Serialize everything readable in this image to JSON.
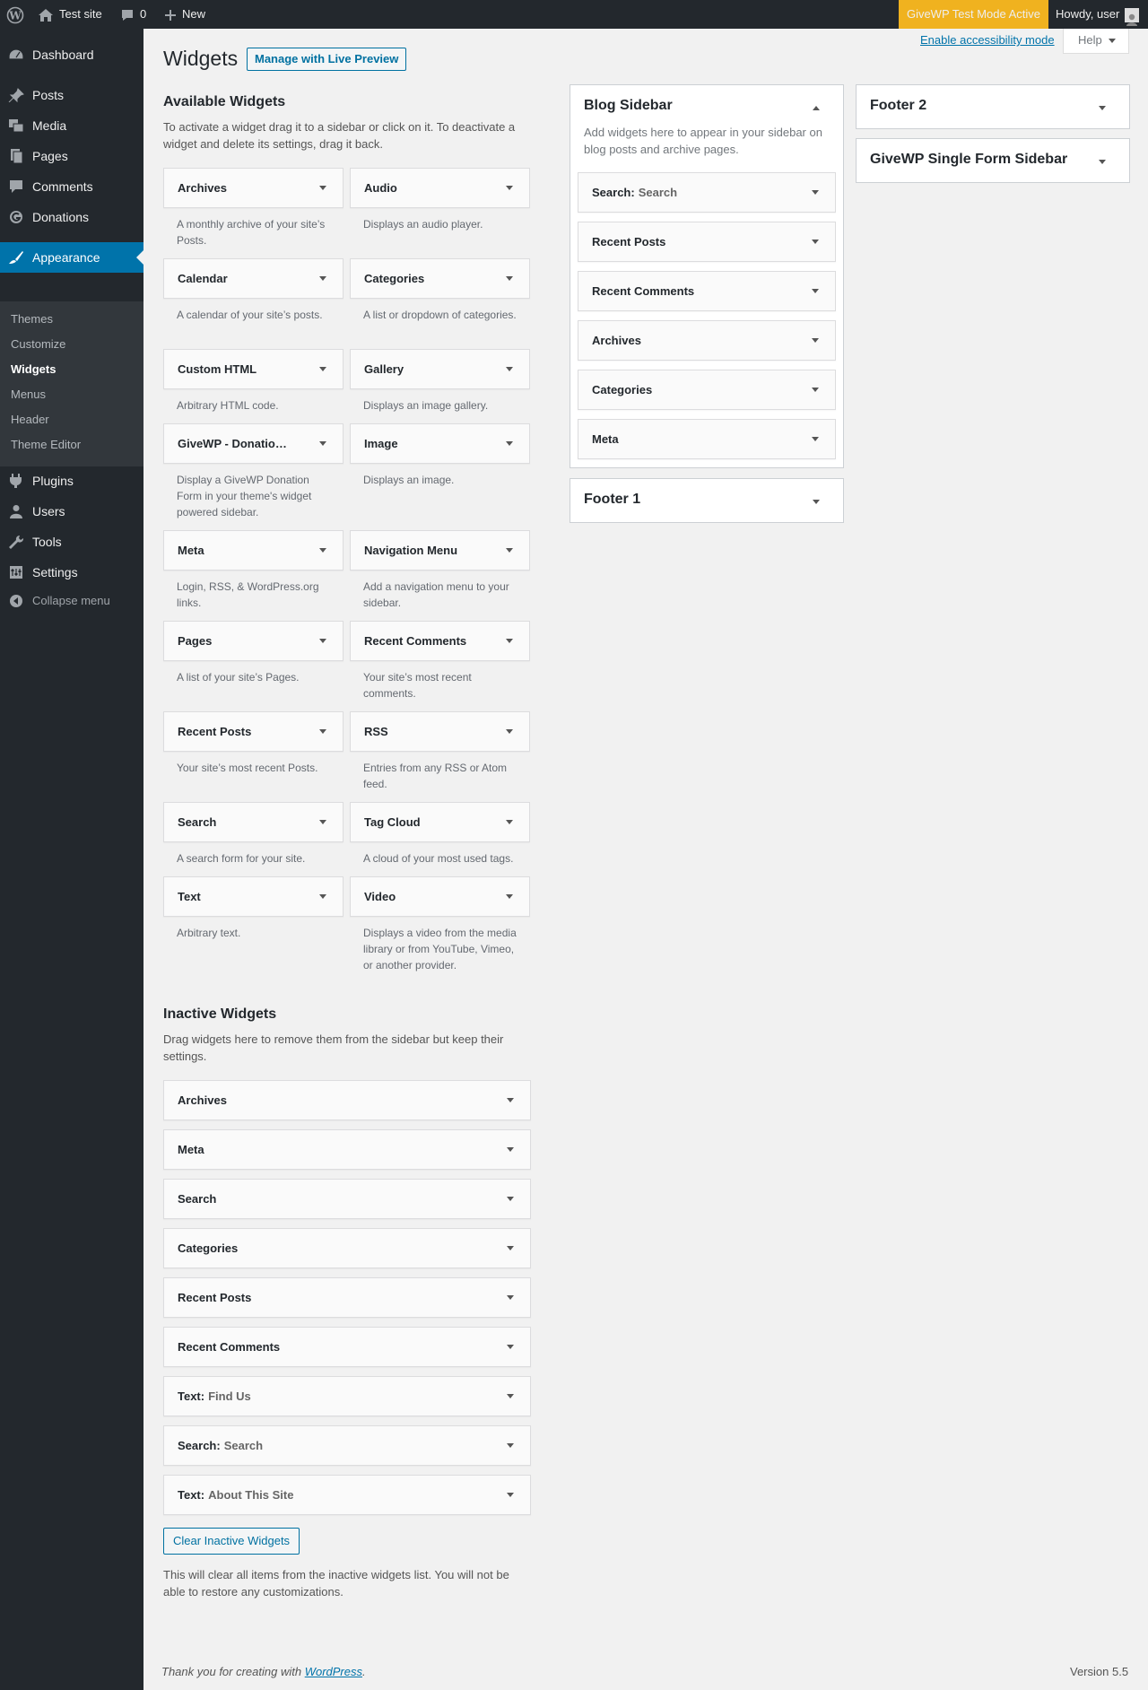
{
  "adminbar": {
    "site_name": "Test site",
    "comments_count": "0",
    "new_label": "New",
    "givewp_notice": "GiveWP Test Mode Active",
    "howdy": "Howdy, user"
  },
  "menu": {
    "items": [
      {
        "label": "Dashboard",
        "icon": "dashboard-icon"
      },
      {
        "label": "Posts",
        "icon": "pin-icon"
      },
      {
        "label": "Media",
        "icon": "media-icon"
      },
      {
        "label": "Pages",
        "icon": "pages-icon"
      },
      {
        "label": "Comments",
        "icon": "comment-icon"
      },
      {
        "label": "Donations",
        "icon": "give-icon"
      },
      {
        "label": "Appearance",
        "icon": "brush-icon"
      },
      {
        "label": "Plugins",
        "icon": "plugin-icon"
      },
      {
        "label": "Users",
        "icon": "users-icon"
      },
      {
        "label": "Tools",
        "icon": "wrench-icon"
      },
      {
        "label": "Settings",
        "icon": "settings-icon"
      }
    ],
    "submenu": [
      "Themes",
      "Customize",
      "Widgets",
      "Menus",
      "Header",
      "Theme Editor"
    ],
    "collapse_label": "Collapse menu"
  },
  "page": {
    "title": "Widgets",
    "live_preview": "Manage with Live Preview",
    "accessibility_link": "Enable accessibility mode",
    "help": "Help"
  },
  "available": {
    "heading": "Available Widgets",
    "description": "To activate a widget drag it to a sidebar or click on it. To deactivate a widget and delete its settings, drag it back.",
    "widgets": [
      {
        "title": "Archives",
        "desc": "A monthly archive of your site’s Posts."
      },
      {
        "title": "Audio",
        "desc": "Displays an audio player."
      },
      {
        "title": "Calendar",
        "desc": "A calendar of your site’s posts."
      },
      {
        "title": "Categories",
        "desc": "A list or dropdown of categories."
      },
      {
        "title": "Custom HTML",
        "desc": "Arbitrary HTML code."
      },
      {
        "title": "Gallery",
        "desc": "Displays an image gallery."
      },
      {
        "title": "GiveWP - Donatio…",
        "desc": "Display a GiveWP Donation Form in your theme's widget powered sidebar."
      },
      {
        "title": "Image",
        "desc": "Displays an image."
      },
      {
        "title": "Meta",
        "desc": "Login, RSS, & WordPress.org links."
      },
      {
        "title": "Navigation Menu",
        "desc": "Add a navigation menu to your sidebar."
      },
      {
        "title": "Pages",
        "desc": "A list of your site’s Pages."
      },
      {
        "title": "Recent Comments",
        "desc": "Your site’s most recent comments."
      },
      {
        "title": "Recent Posts",
        "desc": "Your site’s most recent Posts."
      },
      {
        "title": "RSS",
        "desc": "Entries from any RSS or Atom feed."
      },
      {
        "title": "Search",
        "desc": "A search form for your site."
      },
      {
        "title": "Tag Cloud",
        "desc": "A cloud of your most used tags."
      },
      {
        "title": "Text",
        "desc": "Arbitrary text."
      },
      {
        "title": "Video",
        "desc": "Displays a video from the media library or from YouTube, Vimeo, or another provider."
      }
    ]
  },
  "inactive": {
    "heading": "Inactive Widgets",
    "description": "Drag widgets here to remove them from the sidebar but keep their settings.",
    "widgets": [
      {
        "title": "Archives",
        "sub": ""
      },
      {
        "title": "Meta",
        "sub": ""
      },
      {
        "title": "Search",
        "sub": ""
      },
      {
        "title": "Categories",
        "sub": ""
      },
      {
        "title": "Recent Posts",
        "sub": ""
      },
      {
        "title": "Recent Comments",
        "sub": ""
      },
      {
        "title": "Text:",
        "sub": "Find Us"
      },
      {
        "title": "Search:",
        "sub": "Search"
      },
      {
        "title": "Text:",
        "sub": "About This Site"
      }
    ],
    "clear_button": "Clear Inactive Widgets",
    "clear_note": "This will clear all items from the inactive widgets list. You will not be able to restore any customizations."
  },
  "sidebars": {
    "blog": {
      "title": "Blog Sidebar",
      "description": "Add widgets here to appear in your sidebar on blog posts and archive pages.",
      "widgets": [
        {
          "title": "Search:",
          "sub": "Search"
        },
        {
          "title": "Recent Posts",
          "sub": ""
        },
        {
          "title": "Recent Comments",
          "sub": ""
        },
        {
          "title": "Archives",
          "sub": ""
        },
        {
          "title": "Categories",
          "sub": ""
        },
        {
          "title": "Meta",
          "sub": ""
        }
      ]
    },
    "footer1": {
      "title": "Footer 1"
    },
    "footer2": {
      "title": "Footer 2"
    },
    "givewp_single": {
      "title": "GiveWP Single Form Sidebar"
    }
  },
  "footer": {
    "thanks_prefix": "Thank you for creating with ",
    "thanks_link": "WordPress",
    "thanks_suffix": ".",
    "version": "Version 5.5"
  }
}
